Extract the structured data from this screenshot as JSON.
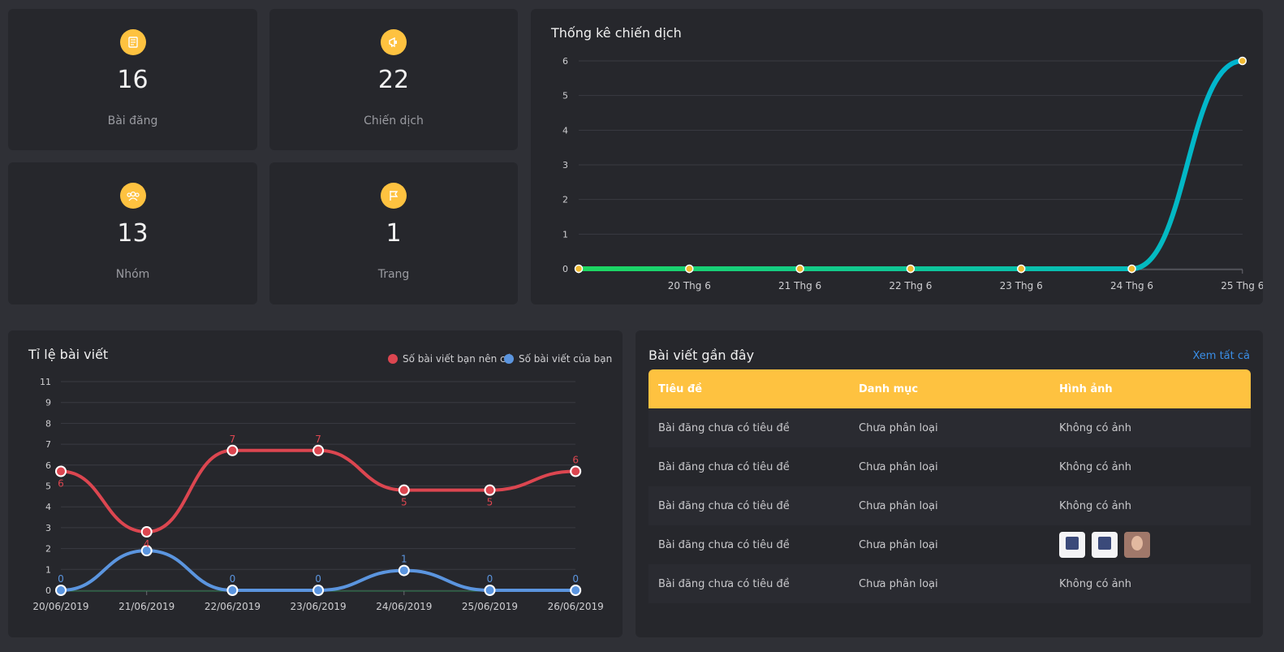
{
  "stats": [
    {
      "value": "16",
      "label": "Bài đăng",
      "icon": "document-icon"
    },
    {
      "value": "22",
      "label": "Chiến dịch",
      "icon": "megaphone-icon"
    },
    {
      "value": "13",
      "label": "Nhóm",
      "icon": "group-icon"
    },
    {
      "value": "1",
      "label": "Trang",
      "icon": "flag-icon"
    }
  ],
  "colors": {
    "accent": "#fec240",
    "link": "#3a8ee6",
    "red": "#dc4650",
    "blue": "#5b95df",
    "green": "#1ed760",
    "teal": "#00b5d0"
  },
  "campaign_chart": {
    "title": "Thống kê chiến dịch"
  },
  "ratio_chart": {
    "title": "Tỉ lệ bài viết",
    "legend": [
      "Số bài viết bạn nên có",
      "Số bài viết của bạn"
    ]
  },
  "recent": {
    "title": "Bài viết gần đây",
    "see_all": "Xem tất cả",
    "columns": [
      "Tiêu đề",
      "Danh mục",
      "Hình ảnh"
    ],
    "rows": [
      {
        "title": "Bài đăng chưa có tiêu đề",
        "category": "Chưa phân loại",
        "image": "Không có ảnh"
      },
      {
        "title": "Bài đăng chưa có tiêu đề",
        "category": "Chưa phân loại",
        "image": "Không có ảnh"
      },
      {
        "title": "Bài đăng chưa có tiêu đề",
        "category": "Chưa phân loại",
        "image": "Không có ảnh"
      },
      {
        "title": "Bài đăng chưa có tiêu đề",
        "category": "Chưa phân loại",
        "image": ""
      },
      {
        "title": "Bài đăng chưa có tiêu đề",
        "category": "Chưa phân loại",
        "image": "Không có ảnh"
      }
    ]
  },
  "chart_data": [
    {
      "type": "area",
      "title": "Thống kê chiến dịch",
      "x": [
        "",
        "20 Thg 6",
        "21 Thg 6",
        "22 Thg 6",
        "23 Thg 6",
        "24 Thg 6",
        "25 Thg 6"
      ],
      "series": [
        {
          "values": [
            0,
            0,
            0,
            0,
            0,
            0,
            6
          ]
        }
      ],
      "yticks": [
        "0",
        "1",
        "2",
        "3",
        "4",
        "5",
        "6"
      ],
      "ylim": [
        0,
        6
      ],
      "grid": true
    },
    {
      "type": "line",
      "title": "Tỉ lệ bài viết",
      "categories": [
        "20/06/2019",
        "21/06/2019",
        "22/06/2019",
        "23/06/2019",
        "24/06/2019",
        "25/06/2019",
        "26/06/2019"
      ],
      "series": [
        {
          "name": "Số bài viết bạn nên có",
          "values": [
            5.7,
            2.8,
            6.7,
            6.7,
            4.8,
            4.8,
            5.7
          ],
          "labels": [
            "6",
            "4",
            "7",
            "7",
            "5",
            "5",
            "6"
          ]
        },
        {
          "name": "Số bài viết của bạn",
          "values": [
            0,
            1.9,
            0,
            0,
            0.95,
            0,
            0
          ],
          "labels": [
            "0",
            "",
            "0",
            "0",
            "1",
            "0",
            "0"
          ]
        }
      ],
      "yticks": [
        "0",
        "1",
        "2",
        "3",
        "4",
        "5",
        "6",
        "7",
        "8",
        "9",
        "11"
      ],
      "ylim": [
        0,
        10
      ],
      "legend": "top-right",
      "grid": true
    }
  ]
}
